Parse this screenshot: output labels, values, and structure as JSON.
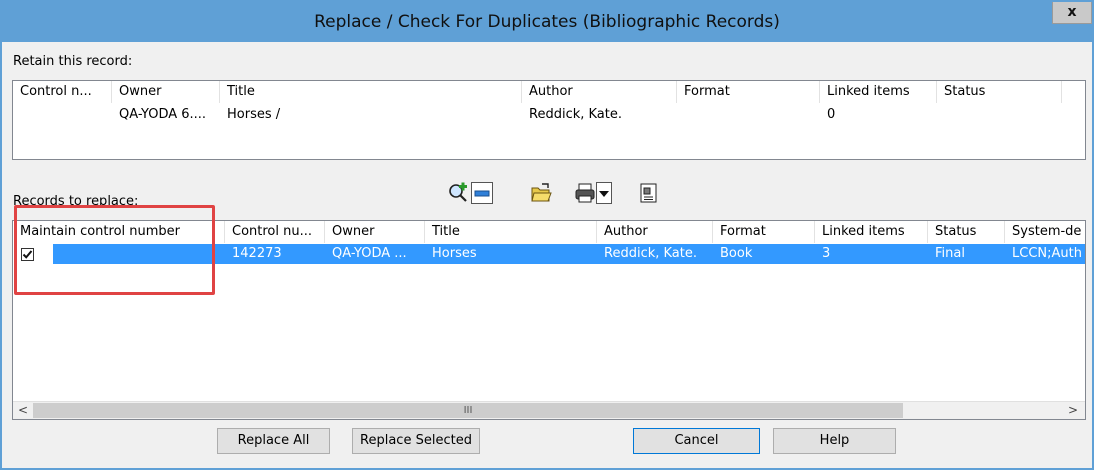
{
  "window": {
    "title": "Replace / Check For Duplicates (Bibliographic Records)",
    "close_label": "x"
  },
  "retain": {
    "label": "Retain this record:",
    "columns": [
      "Control n...",
      "Owner",
      "Title",
      "Author",
      "Format",
      "Linked items",
      "Status"
    ],
    "row": {
      "control": "",
      "owner": "QA-YODA 6....",
      "title": "Horses /",
      "author": "Reddick, Kate.",
      "format": "",
      "linked": "0",
      "status": ""
    }
  },
  "replace": {
    "label": "Records to replace:",
    "columns": [
      "Maintain control number",
      "Control nu...",
      "Owner",
      "Title",
      "Author",
      "Format",
      "Linked items",
      "Status",
      "System-de"
    ],
    "row": {
      "checked": true,
      "control": "142273",
      "owner": "QA-YODA ...",
      "title": "Horses",
      "author": "Reddick, Kate.",
      "format": "Book",
      "linked": "3",
      "status": "Final",
      "system": "LCCN;Auth"
    }
  },
  "scrollbar": {
    "left_arrow": "<",
    "right_arrow": ">",
    "thumb_grip": "III"
  },
  "toolbar": {
    "icons": [
      "find-add-icon",
      "remove-icon",
      "open-folder-icon",
      "print-icon",
      "dropdown-arrow-icon",
      "properties-icon"
    ]
  },
  "buttons": {
    "replace_all": "Replace All",
    "replace_selected": "Replace Selected",
    "cancel": "Cancel",
    "help": "Help"
  },
  "colors": {
    "titlebar": "#5fa0d6",
    "selection": "#3399ff",
    "highlight_box": "#e04343"
  }
}
